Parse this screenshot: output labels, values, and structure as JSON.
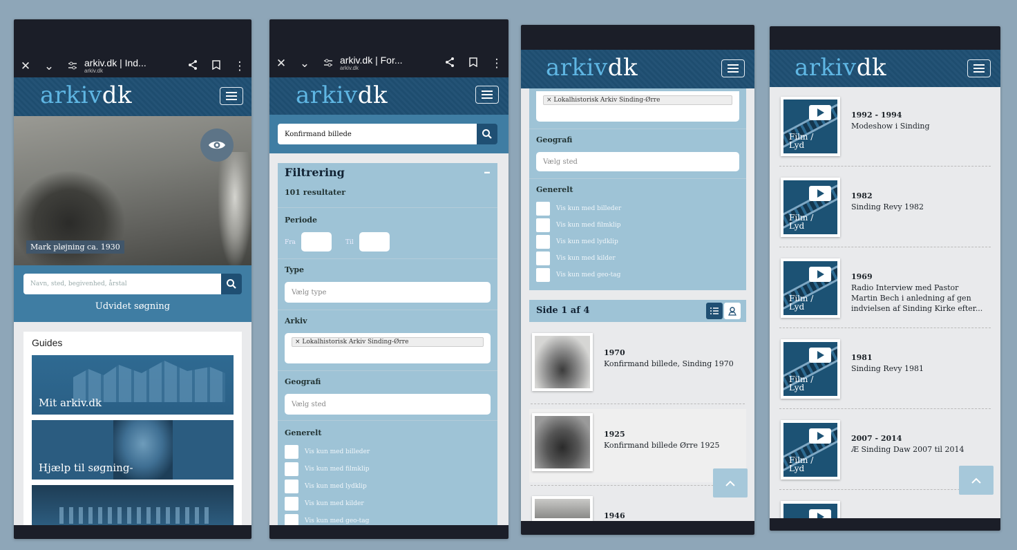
{
  "logo": {
    "part1": "arkiv",
    "part2": "dk"
  },
  "screen1": {
    "browser": {
      "close": "✕",
      "chevron": "⌄",
      "page_title": "arkiv.dk | Ind...",
      "url": "arkiv.dk",
      "more": "⋮"
    },
    "hero_caption": "Mark pløjning ca. 1930",
    "search_placeholder": "Navn, sted, begivenhed, årstal",
    "advanced_search": "Udvidet søgning",
    "guides_title": "Guides",
    "guides": [
      "Mit arkiv.dk",
      "Hjælp til søgning-",
      ""
    ]
  },
  "screen2": {
    "browser": {
      "close": "✕",
      "chevron": "⌄",
      "page_title": "arkiv.dk | For...",
      "url": "arkiv.dk",
      "more": "⋮"
    },
    "search_value": "Konfirmand billede",
    "filter_title": "Filtrering",
    "collapse": "–",
    "results": "101 resultater",
    "period_label": "Periode",
    "from_label": "Fra",
    "to_label": "Til",
    "type_label": "Type",
    "type_placeholder": "Vælg type",
    "archive_label": "Arkiv",
    "archive_tag": "× Lokalhistorisk Arkiv Sinding-Ørre",
    "geo_label": "Geografi",
    "geo_placeholder": "Vælg sted",
    "general_label": "Generelt",
    "checkboxes": [
      "Vis kun med billeder",
      "Vis kun med filmklip",
      "Vis kun med lydklip",
      "Vis kun med kilder",
      "Vis kun med geo-tag"
    ]
  },
  "screen3": {
    "archive_tag": "× Lokalhistorisk Arkiv Sinding-Ørre",
    "geo_label": "Geografi",
    "geo_placeholder": "Vælg sted",
    "general_label": "Generelt",
    "checkboxes": [
      "Vis kun med billeder",
      "Vis kun med filmklip",
      "Vis kun med lydklip",
      "Vis kun med kilder",
      "Vis kun med geo-tag"
    ],
    "page_info": "Side 1 af 4",
    "results": [
      {
        "year": "1970",
        "title": "Konfirmand billede, Sinding 1970"
      },
      {
        "year": "1925",
        "title": "Konfirmand billede Ørre 1925"
      },
      {
        "year": "1946",
        "title": ""
      }
    ]
  },
  "screen4": {
    "media_label": "Film / Lyd",
    "results": [
      {
        "year": "1992 - 1994",
        "title": "Modeshow i Sinding"
      },
      {
        "year": "1982",
        "title": "Sinding Revy 1982"
      },
      {
        "year": "1969",
        "title": "Radio Interview med Pastor Martin Bech i anledning af gen indvielsen af Sinding Kirke efter..."
      },
      {
        "year": "1981",
        "title": "Sinding Revy 1981"
      },
      {
        "year": "2007 - 2014",
        "title": "Æ Sinding Daw 2007 til 2014"
      }
    ]
  },
  "colors": {
    "header": "#1f4f73",
    "panel": "#9ec3d6",
    "accent": "#5fb6e3",
    "dark": "#1b1e28"
  },
  "icons": [
    "close-icon",
    "chevron-down-icon",
    "tune-icon",
    "share-icon",
    "bookmark-icon",
    "more-vert-icon",
    "menu-icon",
    "eye-icon",
    "search-icon",
    "list-view-icon",
    "map-view-icon",
    "chevron-up-icon",
    "play-icon"
  ]
}
